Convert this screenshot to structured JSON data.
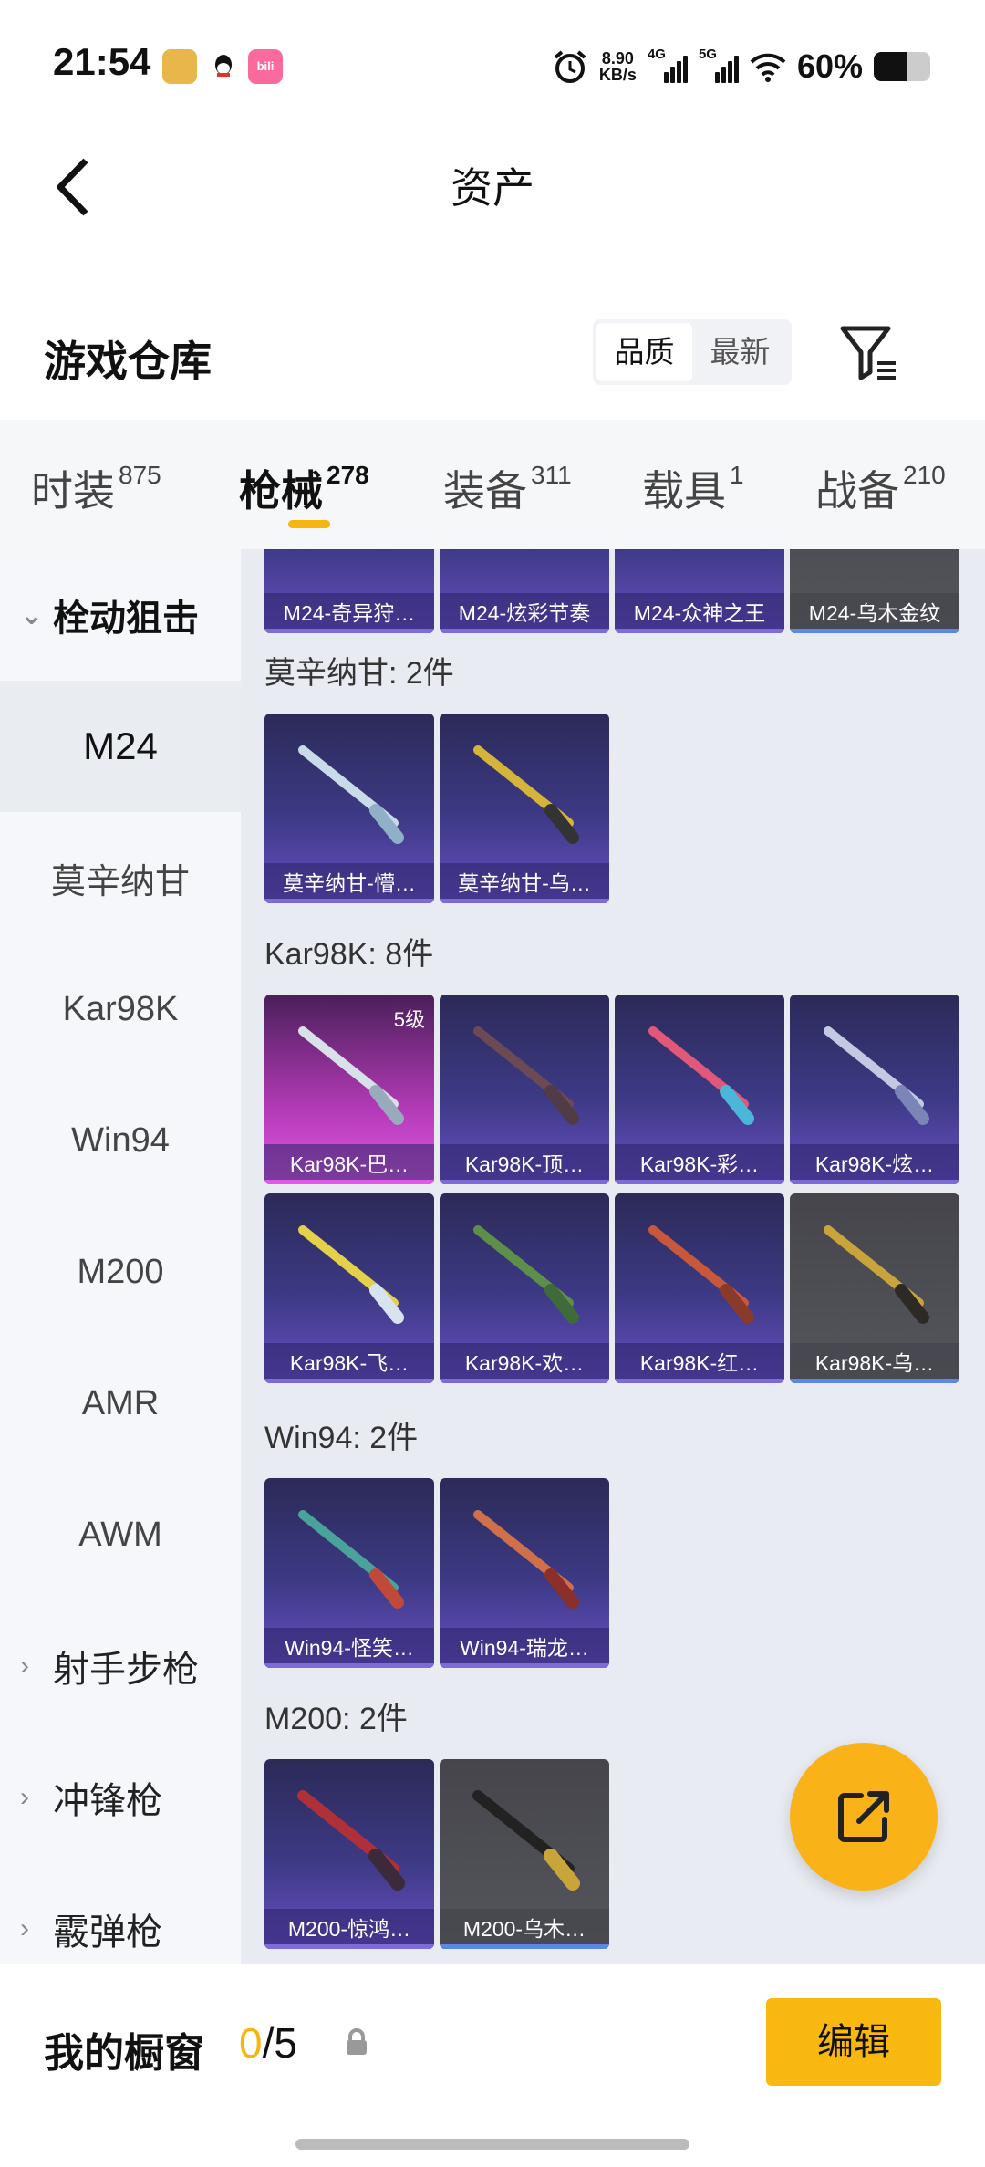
{
  "status_bar": {
    "time": "21:54",
    "apps": [
      "和平营地",
      "QQ",
      "bilibili"
    ],
    "speed_value": "8.90",
    "speed_unit": "KB/s",
    "net1": "4G",
    "net2": "5G",
    "battery_text": "60%",
    "battery_level": 0.6
  },
  "header": {
    "title": "资产"
  },
  "warehouse": {
    "title": "游戏仓库",
    "sort_options": [
      "品质",
      "最新"
    ],
    "active_sort": "品质"
  },
  "tabs": [
    {
      "label": "时装",
      "count": "875"
    },
    {
      "label": "枪械",
      "count": "278",
      "active": true
    },
    {
      "label": "装备",
      "count": "311"
    },
    {
      "label": "载具",
      "count": "1"
    },
    {
      "label": "战备",
      "count": "210"
    }
  ],
  "sidebar": {
    "group_bolt": "栓动狙击",
    "items": [
      "M24",
      "莫辛纳甘",
      "Kar98K",
      "Win94",
      "M200",
      "AMR",
      "AWM"
    ],
    "selected": "M24",
    "groups_after": [
      "射手步枪",
      "冲锋枪",
      "霰弹枪"
    ]
  },
  "content": {
    "top_row": [
      "M24-奇异狩…",
      "M24-炫彩节奏",
      "M24-众神之王",
      "M24-乌木金纹"
    ],
    "sections": [
      {
        "title": "莫辛纳甘: 2件",
        "items": [
          "莫辛纳甘-懵…",
          "莫辛纳甘-乌…"
        ]
      },
      {
        "title": "Kar98K: 8件",
        "items": [
          "Kar98K-巴…",
          "Kar98K-顶…",
          "Kar98K-彩…",
          "Kar98K-炫…",
          "Kar98K-飞…",
          "Kar98K-欢…",
          "Kar98K-红…",
          "Kar98K-乌…"
        ],
        "first_level": "5级"
      },
      {
        "title": "Win94: 2件",
        "items": [
          "Win94-怪笑…",
          "Win94-瑞龙…"
        ]
      },
      {
        "title": "M200: 2件",
        "items": [
          "M200-惊鸿…",
          "M200-乌木…"
        ]
      }
    ]
  },
  "bottom": {
    "title": "我的橱窗",
    "count_current": "0",
    "count_total": "/5",
    "edit_label": "编辑"
  },
  "colors": {
    "accent": "#f9b80f",
    "card_purple": "#3d3a86",
    "card_gray": "#55555d"
  }
}
